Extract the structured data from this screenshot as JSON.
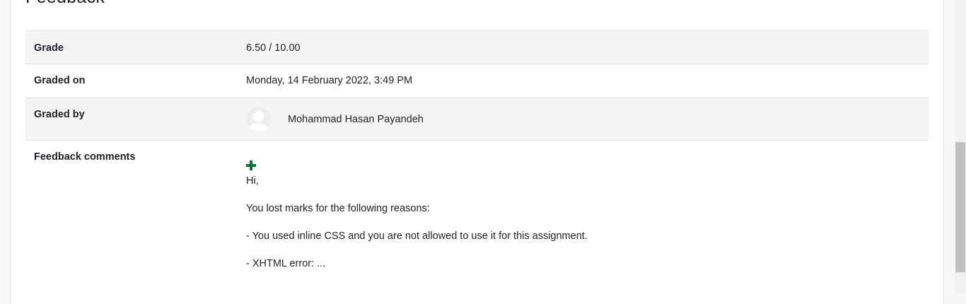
{
  "section": {
    "title": "Feedback"
  },
  "rows": {
    "grade": {
      "label": "Grade",
      "value": "6.50 / 10.00"
    },
    "graded_on": {
      "label": "Graded on",
      "value": "Monday, 14 February 2022, 3:49 PM"
    },
    "graded_by": {
      "label": "Graded by",
      "value": "Mohammad Hasan Payandeh",
      "avatar_icon": "user-avatar-icon"
    },
    "feedback_comments": {
      "label": "Feedback comments",
      "expand_icon": "plus-icon",
      "expand_icon_color": "#0f6d3a",
      "lines": [
        "Hi,",
        "You lost marks for the following reasons:",
        "- You used inline CSS and you are not allowed to use it for this assignment.",
        "- XHTML error: ..."
      ]
    }
  }
}
